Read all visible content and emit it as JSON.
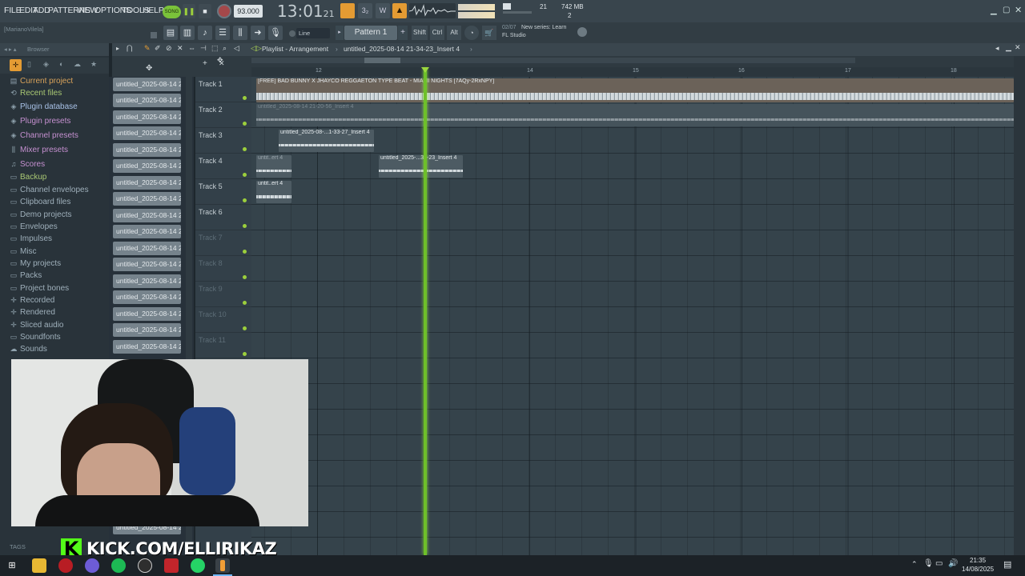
{
  "menu": {
    "file": "FILE",
    "edit": "EDIT",
    "add": "ADD",
    "patterns": "PATTERNS",
    "view": "VIEW",
    "options": "OPTIONS",
    "tools": "TOOLS",
    "help": "HELP"
  },
  "transport": {
    "song_label": "SONG",
    "tempo": "93.000",
    "time": "13:01",
    "time_sub": "21",
    "memory": "742 MB",
    "cpu_val": "21",
    "poly": "2"
  },
  "hint": {
    "user": "[MarianoVilela]",
    "snap": "Line",
    "pattern": "Pattern 1",
    "shift": "Shift",
    "ctrl": "Ctrl",
    "alt": "Alt",
    "news_count": "02/07",
    "news_text": "New series: Learn",
    "news_sub": "FL Studio"
  },
  "playlist": {
    "title": "Playlist - Arrangement",
    "project": "untitled_2025-08-14 21-34-23_Insert 4"
  },
  "browser": {
    "title": "Browser",
    "items": [
      {
        "label": "Current project"
      },
      {
        "label": "Recent files"
      },
      {
        "label": "Plugin database"
      },
      {
        "label": "Plugin presets"
      },
      {
        "label": "Channel presets"
      },
      {
        "label": "Mixer presets"
      },
      {
        "label": "Scores"
      },
      {
        "label": "Backup"
      },
      {
        "label": "Channel envelopes"
      },
      {
        "label": "Clipboard files"
      },
      {
        "label": "Demo projects"
      },
      {
        "label": "Envelopes"
      },
      {
        "label": "Impulses"
      },
      {
        "label": "Misc"
      },
      {
        "label": "My projects"
      },
      {
        "label": "Packs"
      },
      {
        "label": "Project bones"
      },
      {
        "label": "Recorded"
      },
      {
        "label": "Rendered"
      },
      {
        "label": "Sliced audio"
      },
      {
        "label": "Soundfonts"
      },
      {
        "label": "Sounds"
      }
    ],
    "tags": "TAGS"
  },
  "patterns": {
    "label": "untitled_2025-08-14 21-..."
  },
  "tracks": [
    "Track 1",
    "Track 2",
    "Track 3",
    "Track 4",
    "Track 5",
    "Track 6",
    "Track 7",
    "Track 8",
    "Track 9",
    "Track 10",
    "Track 11"
  ],
  "ruler": [
    "12",
    "14",
    "15",
    "16",
    "17",
    "18"
  ],
  "clips": {
    "c1": "[FREE] BAD BUNNY X JHAYCO REGGAETON TYPE BEAT - MIAMI NIGHTS [7AQy-2RxNPY]",
    "c2": "untitled_2025-08-14 21-20-56_Insert 4",
    "c3": "untitled_2025-08-...1-33-27_Insert 4",
    "c4a": "untit..ert 4",
    "c4b": "untitled_2025-...34-23_Insert 4",
    "c5": "untit..ert 4"
  },
  "banner": {
    "text": "KICK.COM/ELLIRIKAZ"
  },
  "taskbar": {
    "time": "21:35",
    "date": "14/08/2025"
  }
}
